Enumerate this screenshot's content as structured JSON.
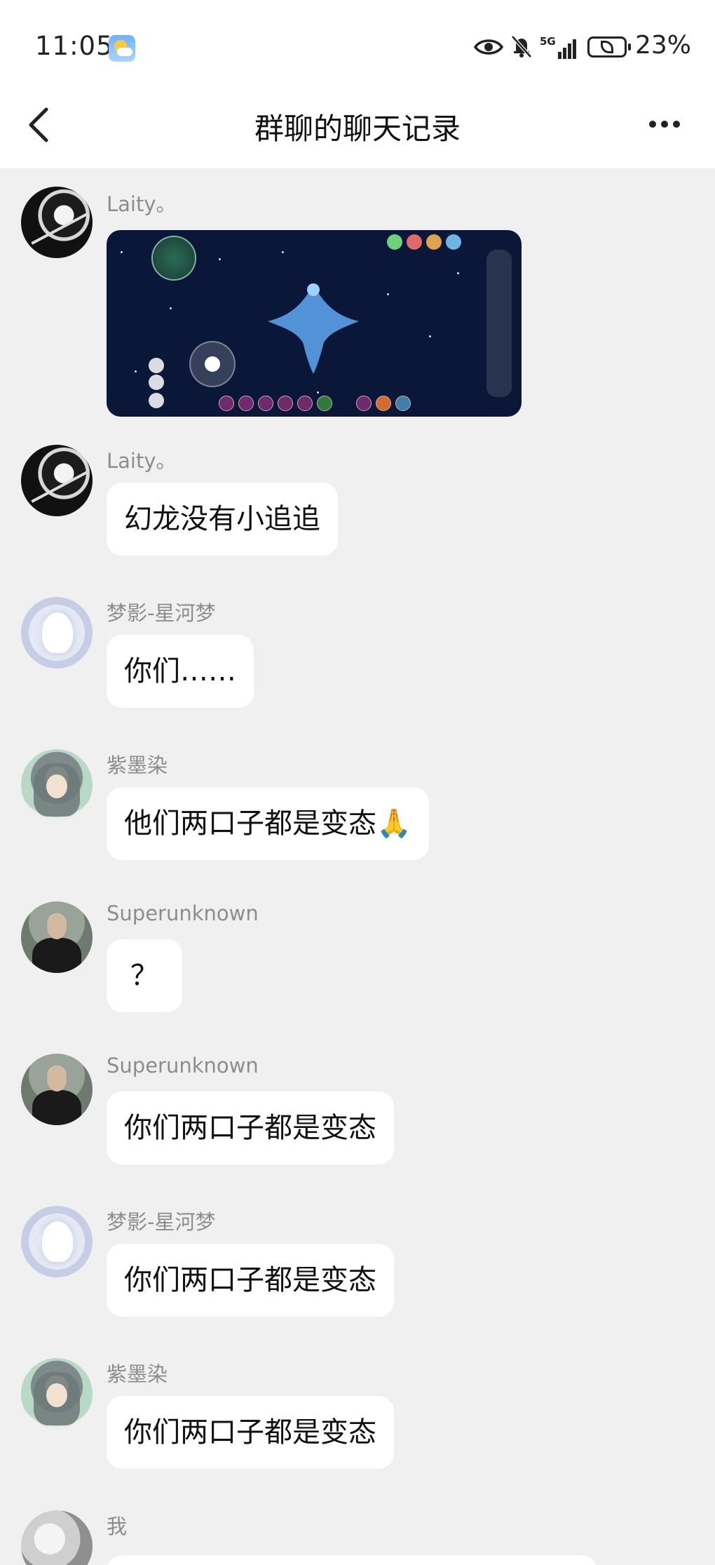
{
  "status_bar": {
    "time": "11:05",
    "network_label": "5G",
    "battery": "23%"
  },
  "nav": {
    "title": "群聊的聊天记录",
    "back_icon": "chevron-left-icon",
    "more_icon": "more-horizontal-icon"
  },
  "messages": [
    {
      "sender": "Laity。",
      "type": "image"
    },
    {
      "sender": "Laity。",
      "text": "幻龙没有小追追"
    },
    {
      "sender": "梦影-星河梦",
      "text": "你们……"
    },
    {
      "sender": "紫墨染",
      "text": "他们两口子都是变态🙏"
    },
    {
      "sender": "Superunknown",
      "text": "？"
    },
    {
      "sender": "Superunknown",
      "text": "你们两口子都是变态"
    },
    {
      "sender": "梦影-星河梦",
      "text": "你们两口子都是变态"
    },
    {
      "sender": "紫墨染",
      "text": "你们两口子都是变态"
    },
    {
      "sender": "我"
    }
  ],
  "colors": {
    "background": "#f0f0f0",
    "bubble": "#ffffff",
    "sender_name": "#8d8d8d",
    "header": "#ffffff"
  }
}
